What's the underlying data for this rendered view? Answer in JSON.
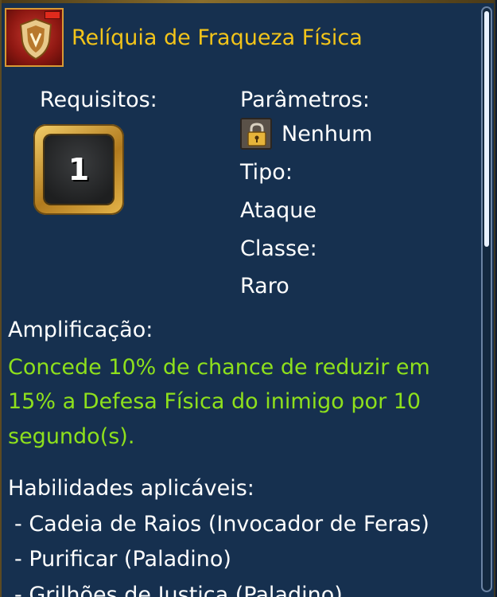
{
  "item": {
    "title": "Relíquia de Fraqueza Física",
    "icon": "shield-relic-icon"
  },
  "requirements": {
    "label": "Requisitos:",
    "level": "1"
  },
  "parameters": {
    "label": "Parâmetros:",
    "lock_icon": "padlock-icon",
    "value": "Nenhum"
  },
  "type": {
    "label": "Tipo:",
    "value": "Ataque"
  },
  "class": {
    "label": "Classe:",
    "value": "Raro"
  },
  "amplification": {
    "label": "Amplificação:",
    "lines": [
      "Concede 10% de chance de reduzir em",
      "15% a Defesa Física do inimigo por 10",
      "segundo(s)."
    ]
  },
  "skills": {
    "label": "Habilidades aplicáveis:",
    "items": [
      "- Cadeia de Raios (Invocador de Feras)",
      "- Purificar (Paladino)",
      "- Grilhões de Justiça (Paladino)"
    ]
  },
  "colors": {
    "background": "#16304f",
    "title": "#f2c41a",
    "effect_text": "#8ee01c"
  }
}
